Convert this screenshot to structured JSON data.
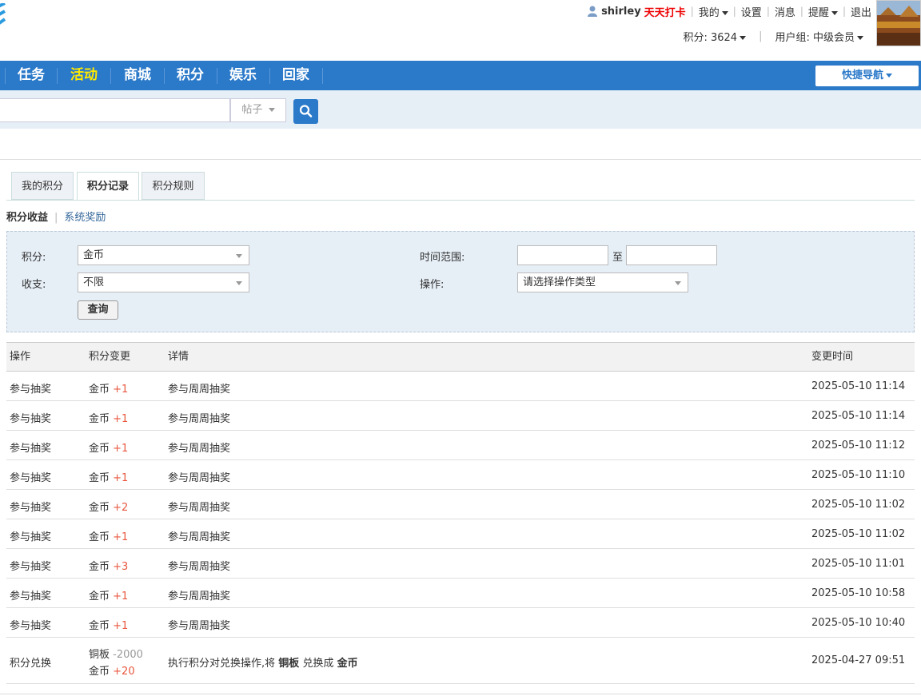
{
  "header": {
    "username": "shirley",
    "checkin_label": "天天打卡",
    "links": [
      "我的",
      "设置",
      "消息",
      "提醒",
      "退出"
    ],
    "points_label": "积分: 3624",
    "usergroup_label": "用户组: 中级会员"
  },
  "nav": {
    "items": [
      "任务",
      "活动",
      "商城",
      "积分",
      "娱乐",
      "回家"
    ],
    "active": "活动",
    "quick_nav_label": "快捷导航"
  },
  "search": {
    "value": "",
    "type_label": "帖子"
  },
  "tabs": [
    "我的积分",
    "积分记录",
    "积分规则"
  ],
  "active_tab": "积分记录",
  "subnav": {
    "active": "积分收益",
    "other": "系统奖励"
  },
  "filter": {
    "points_label": "积分:",
    "points_value": "金币",
    "inout_label": "收支:",
    "inout_value": "不限",
    "time_label": "时间范围:",
    "time_to": "至",
    "time_start": "",
    "time_end": "",
    "op_label": "操作:",
    "op_value": "请选择操作类型",
    "query_button": "查询"
  },
  "table": {
    "headers": [
      "操作",
      "积分变更",
      "详情",
      "变更时间"
    ],
    "rows": [
      {
        "op": "参与抽奖",
        "currency": "金币",
        "change": "+1",
        "detail": "参与周周抽奖",
        "time": "2025-05-10 11:14"
      },
      {
        "op": "参与抽奖",
        "currency": "金币",
        "change": "+1",
        "detail": "参与周周抽奖",
        "time": "2025-05-10 11:14"
      },
      {
        "op": "参与抽奖",
        "currency": "金币",
        "change": "+1",
        "detail": "参与周周抽奖",
        "time": "2025-05-10 11:12"
      },
      {
        "op": "参与抽奖",
        "currency": "金币",
        "change": "+1",
        "detail": "参与周周抽奖",
        "time": "2025-05-10 11:10"
      },
      {
        "op": "参与抽奖",
        "currency": "金币",
        "change": "+2",
        "detail": "参与周周抽奖",
        "time": "2025-05-10 11:02"
      },
      {
        "op": "参与抽奖",
        "currency": "金币",
        "change": "+1",
        "detail": "参与周周抽奖",
        "time": "2025-05-10 11:02"
      },
      {
        "op": "参与抽奖",
        "currency": "金币",
        "change": "+3",
        "detail": "参与周周抽奖",
        "time": "2025-05-10 11:01"
      },
      {
        "op": "参与抽奖",
        "currency": "金币",
        "change": "+1",
        "detail": "参与周周抽奖",
        "time": "2025-05-10 10:58"
      },
      {
        "op": "参与抽奖",
        "currency": "金币",
        "change": "+1",
        "detail": "参与周周抽奖",
        "time": "2025-05-10 10:40"
      }
    ],
    "exchange_row": {
      "op": "积分兑换",
      "from_currency": "铜板",
      "from_change": "-2000",
      "to_currency": "金币",
      "to_change": "+20",
      "detail_prefix": "执行积分对兑换操作,将",
      "detail_from": "铜板",
      "detail_mid": "兑换成",
      "detail_to": "金币",
      "time": "2025-04-27 09:51"
    }
  },
  "colors": {
    "nav_bg": "#2b79c9",
    "nav_active": "#ffea00",
    "positive_amount": "#e9573f",
    "checkin": "#ee0000"
  }
}
